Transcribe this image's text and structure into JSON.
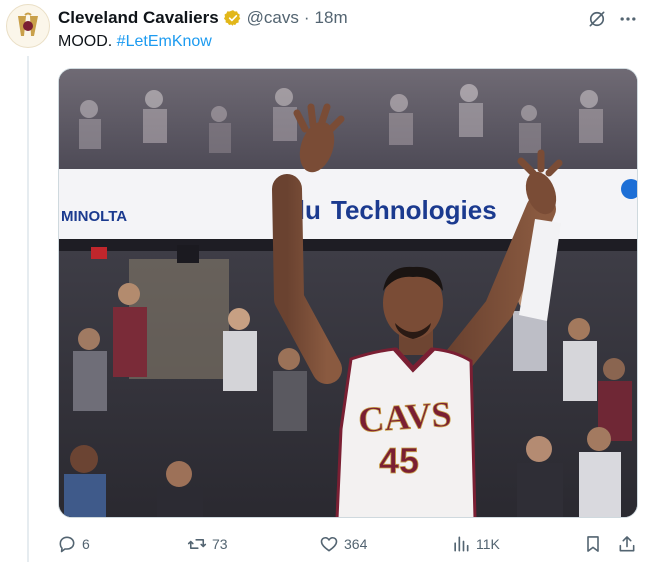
{
  "tweet": {
    "author_name": "Cleveland Cavaliers",
    "handle": "@cavs",
    "separator": "·",
    "time": "18m",
    "text": "MOOD.",
    "hashtag": "#LetEmKnow"
  },
  "media": {
    "banner_left": "MINOLTA",
    "banner_main_prefix": "Blu",
    "banner_main": "Technologies",
    "jersey_team": "CAVS",
    "jersey_number": "45"
  },
  "actions": {
    "replies": "6",
    "reposts": "73",
    "likes": "364",
    "views": "11K"
  },
  "icons": {
    "avatar": "cavs-logo-icon",
    "verified": "verified-badge-icon",
    "grok": "grok-icon",
    "more": "more-icon",
    "reply": "reply-icon",
    "repost": "repost-icon",
    "like": "like-icon",
    "views": "views-icon",
    "bookmark": "bookmark-icon",
    "share": "share-icon"
  },
  "colors": {
    "link": "#1d9bf0",
    "verified_badge": "#e2b719",
    "wine": "#7a1f33",
    "gold": "#c9a04a",
    "banner_blue": "#1b3a8f"
  }
}
